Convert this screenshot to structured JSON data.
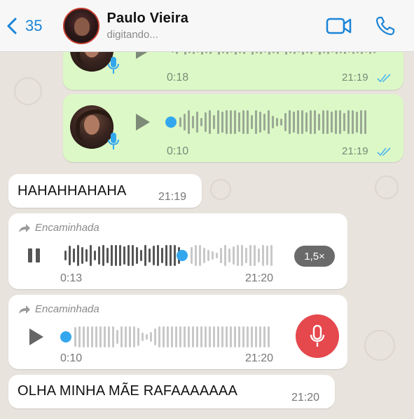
{
  "header": {
    "back_count": "35",
    "contact_name": "Paulo Vieira",
    "status": "digitando..."
  },
  "messages": [
    {
      "type": "voice",
      "direction": "outgoing",
      "duration": "0:18",
      "time": "21:19"
    },
    {
      "type": "voice",
      "direction": "outgoing",
      "duration": "0:10",
      "time": "21:19"
    },
    {
      "type": "text",
      "direction": "incoming",
      "text": "HAHAHHAHAHA",
      "time": "21:19"
    },
    {
      "type": "voice",
      "direction": "incoming",
      "forwarded_label": "Encaminhada",
      "elapsed": "0:13",
      "time": "21:20",
      "speed": "1,5×",
      "state": "playing",
      "progress": 0.55
    },
    {
      "type": "voice",
      "direction": "incoming",
      "forwarded_label": "Encaminhada",
      "duration": "0:10",
      "time": "21:20",
      "state": "paused",
      "progress": 0
    },
    {
      "type": "text",
      "direction": "incoming",
      "text": "OLHA MINHA MÃE RAFAAAAAAA",
      "time": "21:20"
    }
  ],
  "colors": {
    "accent": "#1a84d8",
    "outgoing_bubble": "#dcf8c6",
    "incoming_bubble": "#ffffff",
    "progress_dot": "#33a7ee",
    "mic_button": "#e5484d",
    "read_ticks": "#4fb6ec"
  },
  "icons": [
    "chevron-left-icon",
    "video-call-icon",
    "phone-icon",
    "play-icon",
    "pause-icon",
    "microphone-icon",
    "forward-arrow-icon",
    "double-check-icon"
  ]
}
